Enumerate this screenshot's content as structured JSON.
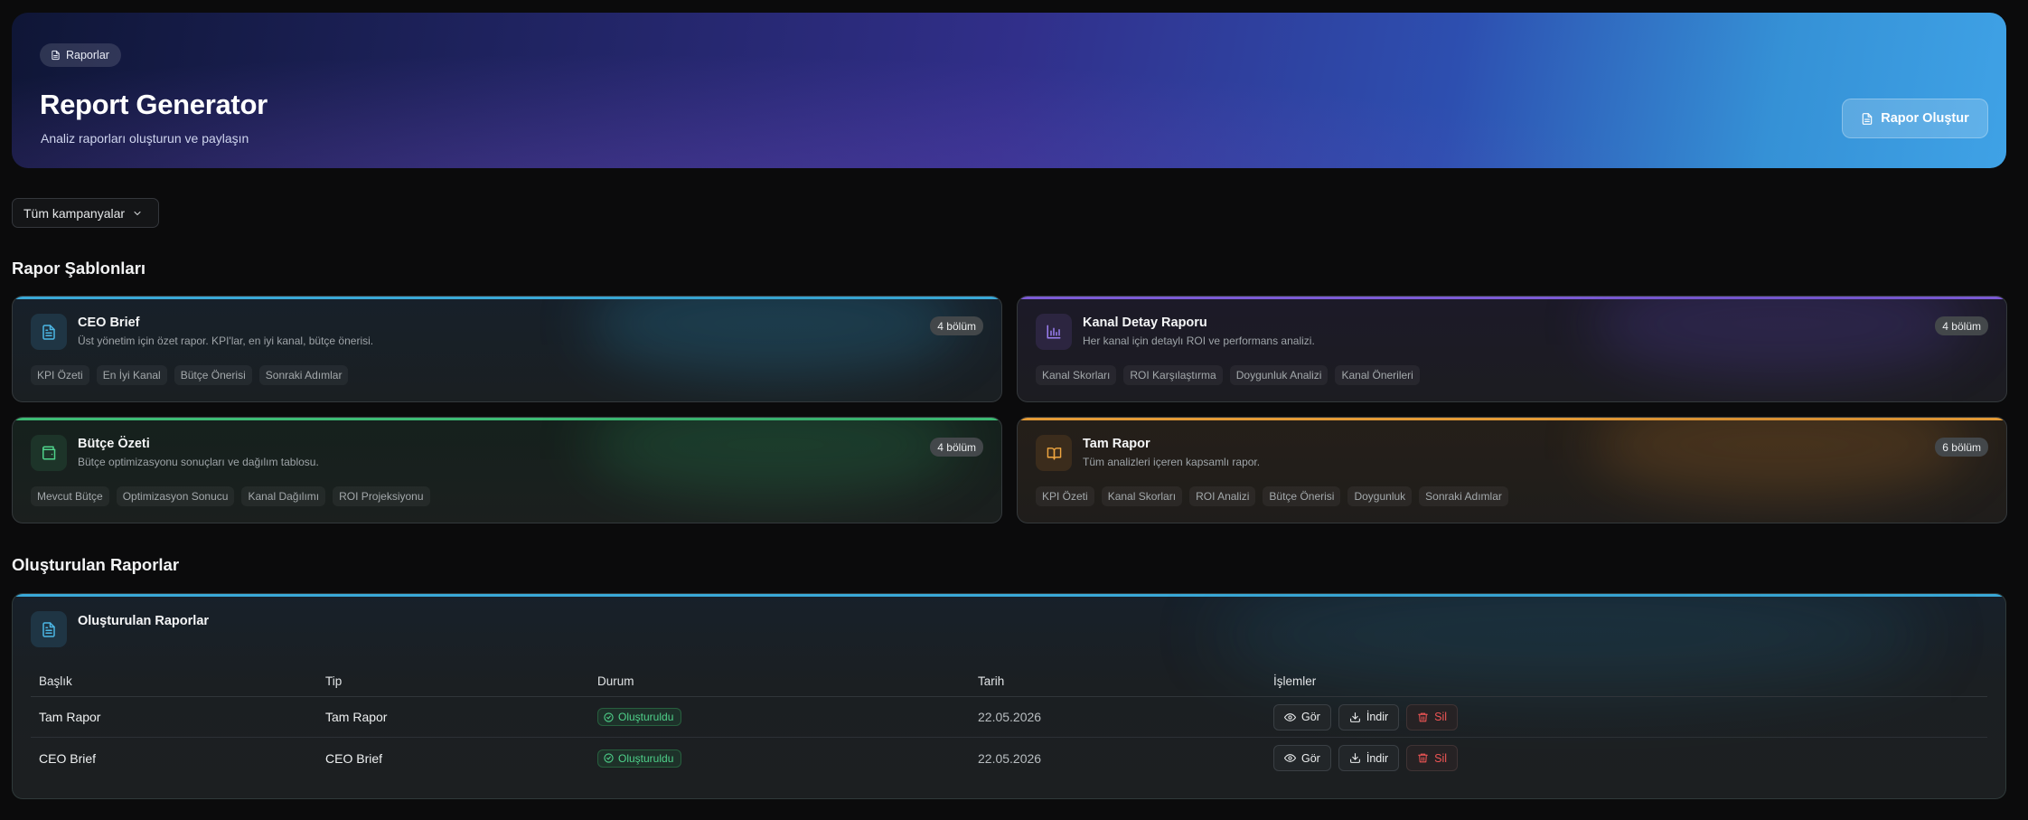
{
  "hero": {
    "breadcrumb": "Raporlar",
    "title": "Report Generator",
    "subtitle": "Analiz raporları oluşturun ve paylaşın",
    "create_button": "Rapor Oluştur"
  },
  "filter": {
    "selected": "Tüm kampanyalar"
  },
  "templates_section": {
    "title": "Rapor Şablonları",
    "cards": [
      {
        "title": "CEO Brief",
        "description": "Üst yönetim için özet rapor. KPI'lar, en iyi kanal, bütçe önerisi.",
        "badge": "4 bölüm",
        "tags": [
          "KPI Özeti",
          "En İyi Kanal",
          "Bütçe Önerisi",
          "Sonraki Adımlar"
        ],
        "icon": "document-icon",
        "accent": "#3aa9d8"
      },
      {
        "title": "Kanal Detay Raporu",
        "description": "Her kanal için detaylı ROI ve performans analizi.",
        "badge": "4 bölüm",
        "tags": [
          "Kanal Skorları",
          "ROI Karşılaştırma",
          "Doygunluk Analizi",
          "Kanal Önerileri"
        ],
        "icon": "bar-chart-icon",
        "accent": "#7c5bd6"
      },
      {
        "title": "Bütçe Özeti",
        "description": "Bütçe optimizasyonu sonuçları ve dağılım tablosu.",
        "badge": "4 bölüm",
        "tags": [
          "Mevcut Bütçe",
          "Optimizasyon Sonucu",
          "Kanal Dağılımı",
          "ROI Projeksiyonu"
        ],
        "icon": "wallet-icon",
        "accent": "#3dbb74"
      },
      {
        "title": "Tam Rapor",
        "description": "Tüm analizleri içeren kapsamlı rapor.",
        "badge": "6 bölüm",
        "tags": [
          "KPI Özeti",
          "Kanal Skorları",
          "ROI Analizi",
          "Bütçe Önerisi",
          "Doygunluk",
          "Sonraki Adımlar"
        ],
        "icon": "book-icon",
        "accent": "#e39a36"
      }
    ]
  },
  "reports_section": {
    "title": "Oluşturulan Raporlar",
    "panel_title": "Oluşturulan Raporlar",
    "columns": [
      "Başlık",
      "Tip",
      "Durum",
      "Tarih",
      "İşlemler"
    ],
    "rows": [
      {
        "title": "Tam Rapor",
        "type": "Tam Rapor",
        "status": "Oluşturuldu",
        "date": "22.05.2026"
      },
      {
        "title": "CEO Brief",
        "type": "CEO Brief",
        "status": "Oluşturuldu",
        "date": "22.05.2026"
      }
    ],
    "actions": {
      "view": "Gör",
      "download": "İndir",
      "delete": "Sil"
    }
  }
}
